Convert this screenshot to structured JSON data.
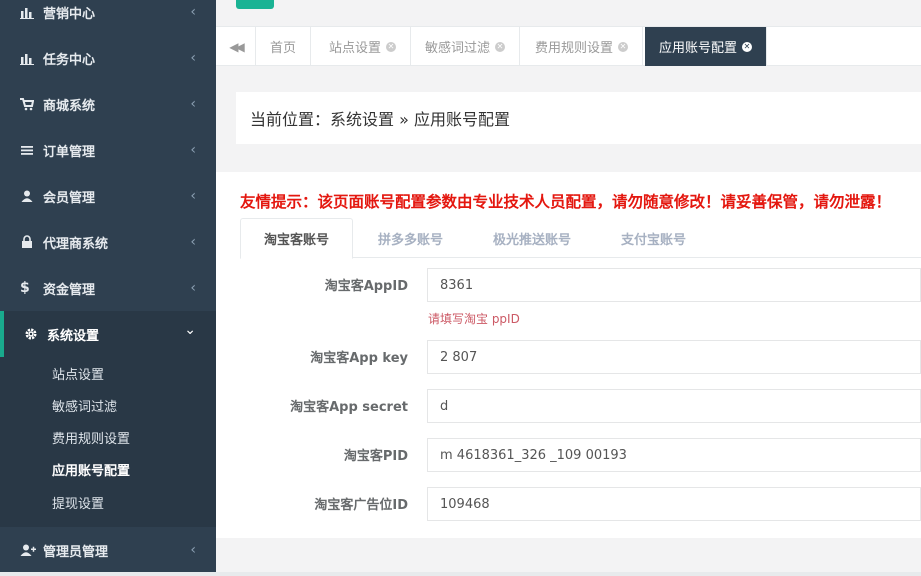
{
  "sidebar": {
    "items": [
      {
        "label": "营销中心",
        "icon": "bar-chart-icon"
      },
      {
        "label": "任务中心",
        "icon": "bar-chart-icon"
      },
      {
        "label": "商城系统",
        "icon": "cart-icon"
      },
      {
        "label": "订单管理",
        "icon": "list-icon"
      },
      {
        "label": "会员管理",
        "icon": "user-icon"
      },
      {
        "label": "代理商系统",
        "icon": "lock-icon"
      },
      {
        "label": "资金管理",
        "icon": "dollar-icon"
      },
      {
        "label": "系统设置",
        "icon": "gear-icon"
      },
      {
        "label": "管理员管理",
        "icon": "user-plus-icon"
      }
    ],
    "sub_items": [
      {
        "label": "站点设置"
      },
      {
        "label": "敏感词过滤"
      },
      {
        "label": "费用规则设置"
      },
      {
        "label": "应用账号配置"
      },
      {
        "label": "提现设置"
      }
    ],
    "chevron_left": "‹",
    "chevron_down": "⌄"
  },
  "tabs": {
    "back_icon": "◀◀",
    "items": [
      {
        "label": "首页"
      },
      {
        "label": "站点设置"
      },
      {
        "label": "敏感词过滤"
      },
      {
        "label": "费用规则设置"
      },
      {
        "label": "应用账号配置"
      }
    ],
    "close_glyph": "✕"
  },
  "breadcrumb": "当前位置：系统设置 » 应用账号配置",
  "notice": "友情提示：该页面账号配置参数由专业技术人员配置，请勿随意修改！请妥善保管，请勿泄露！",
  "account_tabs": [
    {
      "label": "淘宝客账号"
    },
    {
      "label": "拼多多账号"
    },
    {
      "label": "极光推送账号"
    },
    {
      "label": "支付宝账号"
    }
  ],
  "form": {
    "fields": [
      {
        "label": "淘宝客AppID",
        "value": "8361",
        "help": "请填写淘宝 ppID"
      },
      {
        "label": "淘宝客App key",
        "value": "2 807"
      },
      {
        "label": "淘宝客App secret",
        "value": "d"
      },
      {
        "label": "淘宝客PID",
        "value": "m 4618361_326 _109 00193"
      },
      {
        "label": "淘宝客广告位ID",
        "value": "109468"
      }
    ]
  },
  "colors": {
    "sidebar_bg": "#2f4050",
    "accent": "#1ab394",
    "notice_red": "#e4170f"
  }
}
